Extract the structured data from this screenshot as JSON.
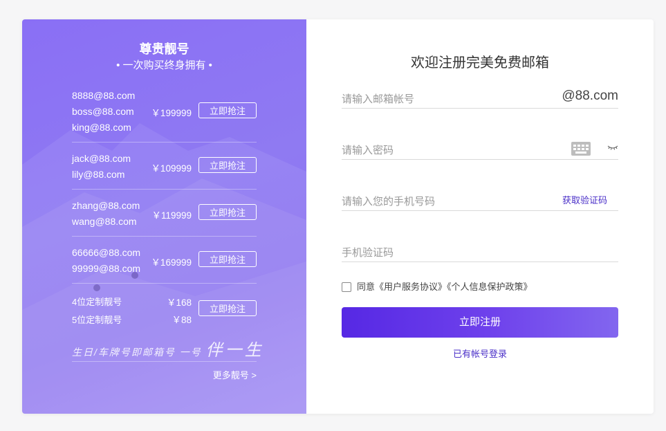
{
  "promo": {
    "title": "尊贵靓号",
    "subtitle": "• 一次购买终身拥有 •",
    "groups": [
      {
        "emails": [
          "8888@88.com",
          "boss@88.com",
          "king@88.com"
        ],
        "price": "￥199999",
        "button": "立即抢注"
      },
      {
        "emails": [
          "jack@88.com",
          "lily@88.com"
        ],
        "price": "￥109999",
        "button": "立即抢注"
      },
      {
        "emails": [
          "zhang@88.com",
          "wang@88.com"
        ],
        "price": "￥119999",
        "button": "立即抢注"
      },
      {
        "emails": [
          "66666@88.com",
          "99999@88.com"
        ],
        "price": "￥169999",
        "button": "立即抢注"
      }
    ],
    "custom": {
      "items": [
        {
          "label": "4位定制靓号",
          "price": "￥168"
        },
        {
          "label": "5位定制靓号",
          "price": "￥88"
        }
      ],
      "button": "立即抢注"
    },
    "slogan_small": "生日/车牌号即邮箱号 一号",
    "slogan_big": "伴一生",
    "more_link": "更多靓号 >"
  },
  "form": {
    "title": "欢迎注册完美免费邮箱",
    "email_placeholder": "请输入邮箱帐号",
    "email_suffix": "@88.com",
    "password_placeholder": "请输入密码",
    "phone_placeholder": "请输入您的手机号码",
    "get_code_link": "获取验证码",
    "code_placeholder": "手机验证码",
    "agreement": "同意《用户服务协议》《个人信息保护政策》",
    "submit_label": "立即注册",
    "login_link": "已有帐号登录"
  },
  "colors": {
    "accent": "#5628e4",
    "promo_bg": "#8d74f1",
    "link": "#4a2fc8"
  }
}
